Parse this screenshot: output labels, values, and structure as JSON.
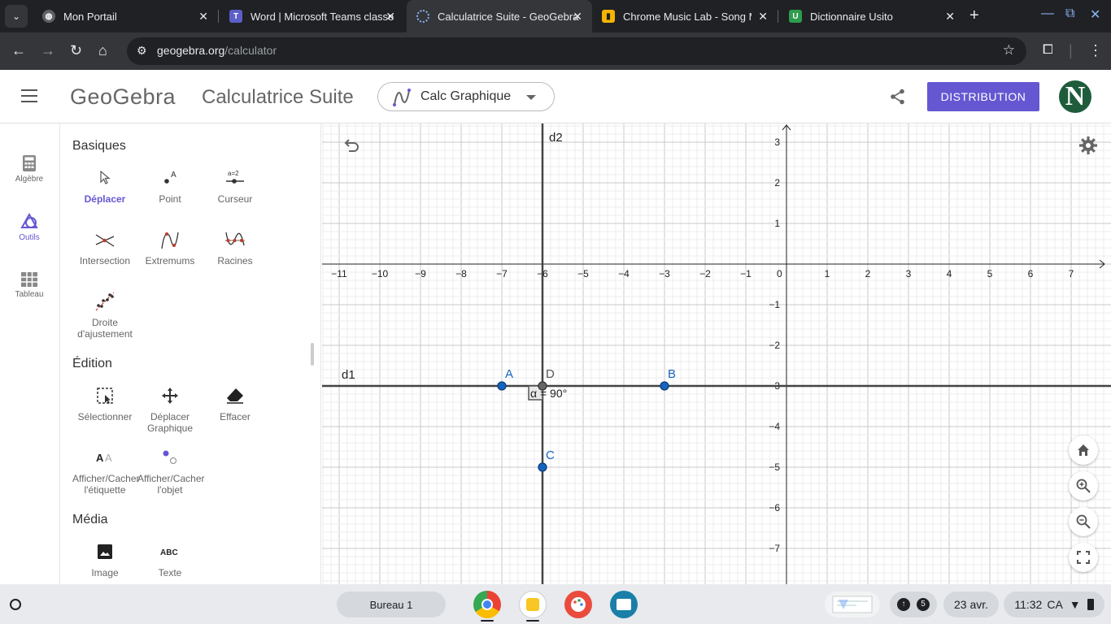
{
  "browser": {
    "tabs": [
      {
        "title": "Mon Portail",
        "icon": "globe-icon"
      },
      {
        "title": "Word | Microsoft Teams classe",
        "icon": "teams-icon"
      },
      {
        "title": "Calculatrice Suite - GeoGebra",
        "icon": "geogebra-icon",
        "active": true
      },
      {
        "title": "Chrome Music Lab - Song Maker",
        "icon": "music-lab-icon"
      },
      {
        "title": "Dictionnaire Usito",
        "icon": "usito-icon"
      }
    ],
    "url_host": "geogebra.org",
    "url_path": "/calculator"
  },
  "header": {
    "logo": "GeoGebra",
    "app_title": "Calculatrice Suite",
    "calc_select": "Calc Graphique",
    "distribution": "DISTRIBUTION",
    "avatar_letter": "N",
    "accent": "#6557d2"
  },
  "rail": {
    "algebre": "Algèbre",
    "outils": "Outils",
    "tableau": "Tableau"
  },
  "tools": {
    "basiques": "Basiques",
    "deplacer": "Déplacer",
    "point": "Point",
    "curseur": "Curseur",
    "intersection": "Intersection",
    "extremums": "Extremums",
    "racines": "Racines",
    "droite_ajust_1": "Droite",
    "droite_ajust_2": "d'ajustement",
    "edition": "Édition",
    "selectionner": "Sélectionner",
    "depl_graph_1": "Déplacer",
    "depl_graph_2": "Graphique",
    "effacer": "Effacer",
    "aff_etiq_1": "Afficher/Cacher",
    "aff_etiq_2": "l'étiquette",
    "aff_obj_1": "Afficher/Cacher",
    "aff_obj_2": "l'objet",
    "media": "Média",
    "image": "Image",
    "texte": "Texte"
  },
  "graph": {
    "x_ticks": [
      "−11",
      "−10",
      "−9",
      "−8",
      "−7",
      "−6",
      "−5",
      "−4",
      "−3",
      "−2",
      "−1",
      "0",
      "1",
      "2",
      "3",
      "4",
      "5",
      "6",
      "7"
    ],
    "y_ticks_pos": [
      "3",
      "2",
      "1"
    ],
    "y_ticks_neg": [
      "−1",
      "−2",
      "−3",
      "−4",
      "−5",
      "−6",
      "−7"
    ],
    "line_d1": "d1",
    "line_d2": "d2",
    "point_a": "A",
    "point_b": "B",
    "point_c": "C",
    "point_d": "D",
    "angle_label": "α = 90°",
    "points": {
      "A": [
        -7,
        -3
      ],
      "B": [
        -3,
        -3
      ],
      "C": [
        -6,
        -5
      ],
      "D": [
        -6,
        -3
      ]
    }
  },
  "shelf": {
    "desk": "Bureau 1",
    "notif_count": "5",
    "date": "23 avr.",
    "time": "11:32",
    "locale": "CA"
  }
}
